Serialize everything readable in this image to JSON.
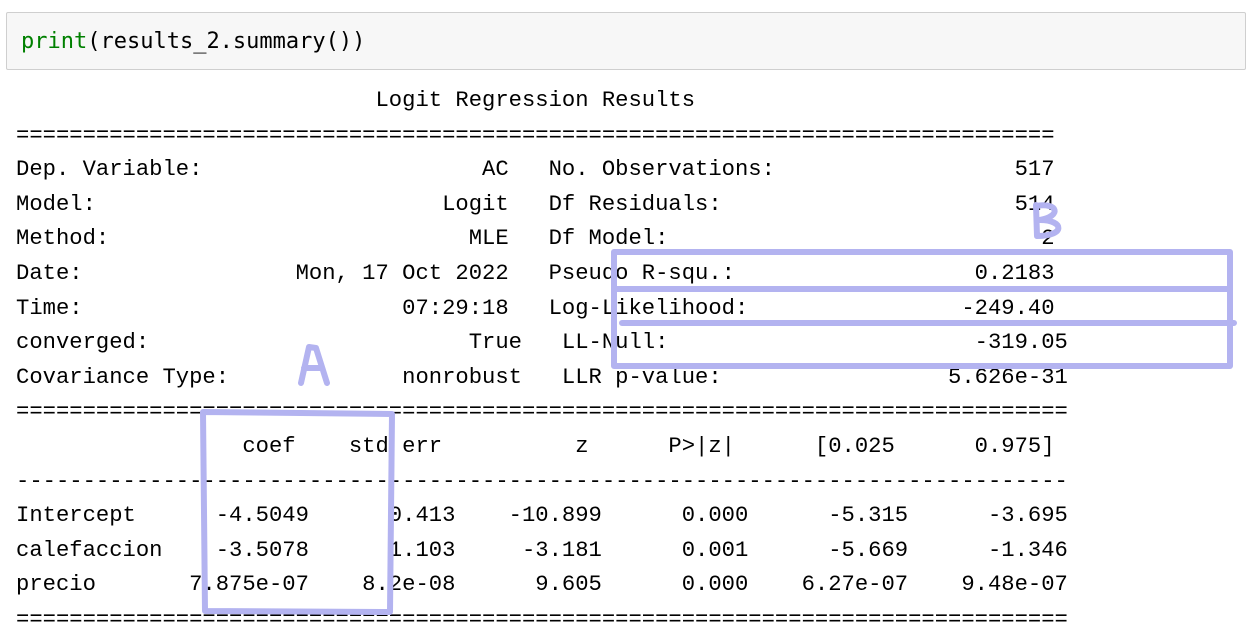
{
  "code": {
    "fn": "print",
    "args": "(results_2.summary())"
  },
  "output": {
    "lines": [
      "                           Logit Regression Results                           ",
      "==============================================================================",
      "Dep. Variable:                     AC   No. Observations:                  517",
      "Model:                          Logit   Df Residuals:                      514",
      "Method:                           MLE   Df Model:                            2",
      "Date:                Mon, 17 Oct 2022   Pseudo R-squ.:                  0.2183",
      "Time:                        07:29:18   Log-Likelihood:                -249.40",
      "converged:                        True   LL-Null:                       -319.05",
      "Covariance Type:             nonrobust   LLR p-value:                 5.626e-31",
      "===============================================================================",
      "                 coef    std err          z      P>|z|      [0.025      0.975]",
      "-------------------------------------------------------------------------------",
      "Intercept      -4.5049      0.413    -10.899      0.000      -5.315      -3.695",
      "calefaccion    -3.5078      1.103     -3.181      0.001      -5.669      -1.346",
      "precio       7.875e-07    8.2e-08      9.605      0.000    6.27e-07    9.48e-07",
      "==============================================================================="
    ]
  },
  "annotations": {
    "label_a": "A",
    "label_b": "B",
    "color": "#b3b3f0"
  }
}
